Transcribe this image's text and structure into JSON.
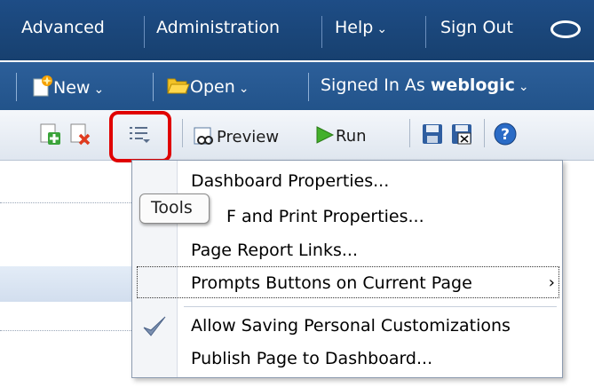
{
  "topbar": {
    "advanced": "Advanced",
    "administration": "Administration",
    "help": "Help",
    "sign_out": "Sign Out",
    "logo": "oracle-logo-icon"
  },
  "secbar": {
    "new": "New",
    "open": "Open",
    "signed_in_as": "Signed In As",
    "user": "weblogic"
  },
  "toolbar": {
    "preview": "Preview",
    "run": "Run"
  },
  "tooltip": "Tools",
  "menu": {
    "items": [
      "Dashboard Properties...",
      "Print and PDF and Print Properties...",
      "Page Report Links...",
      "Prompts Buttons on Current Page",
      "Allow Saving Personal Customizations",
      "Publish Page to Dashboard..."
    ],
    "visible_item_1": "F and Print Properties...",
    "checked_item": "Allow Saving Personal Customizations"
  },
  "colors": {
    "topbar": "#1e4d86",
    "secbar": "#2c5f9a",
    "highlight": "#e00000"
  }
}
